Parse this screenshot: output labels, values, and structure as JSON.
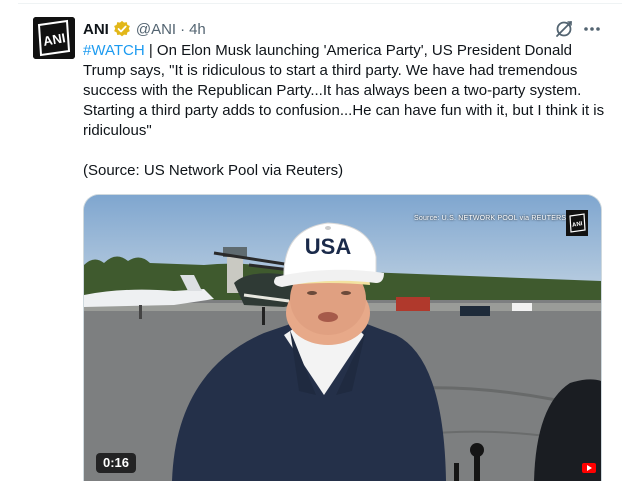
{
  "tweet": {
    "author_name": "ANI",
    "handle": "@ANI",
    "separator": "·",
    "time": "4h",
    "hashtag": "#WATCH",
    "body": " | On Elon Musk launching 'America Party', US President Donald Trump says, \"It is ridiculous to start a third party. We have had tremendous success with the Republican Party...It has always been a two-party system. Starting a third party adds to confusion...He can have fun with it, but I think it is ridiculous\"",
    "source": "(Source: US Network Pool via Reuters)",
    "avatar_text": "ANI"
  },
  "media": {
    "watermark": "Source: U.S. NETWORK POOL via REUTERS",
    "cap_text": "USA",
    "duration": "0:16"
  },
  "icons": {
    "verified": "verified-badge-icon",
    "grok": "grok-icon",
    "more": "more-options-icon"
  },
  "colors": {
    "link": "#1d9bf0",
    "verified_gold": "#e2b719",
    "muted": "#536471"
  }
}
